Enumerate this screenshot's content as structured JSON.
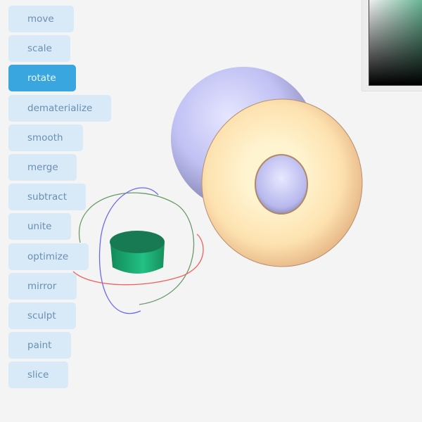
{
  "toolbar": {
    "active_tool": "rotate",
    "tools": [
      {
        "label": "move"
      },
      {
        "label": "scale"
      },
      {
        "label": "rotate"
      },
      {
        "label": "dematerialize"
      },
      {
        "label": "smooth"
      },
      {
        "label": "merge"
      },
      {
        "label": "subtract"
      },
      {
        "label": "unite"
      },
      {
        "label": "optimize"
      },
      {
        "label": "mirror"
      },
      {
        "label": "sculpt"
      },
      {
        "label": "paint"
      },
      {
        "label": "slice"
      }
    ]
  },
  "scene": {
    "objects": [
      {
        "name": "sphere",
        "color": "#c8c8f8"
      },
      {
        "name": "torus",
        "color": "#fcd9a4"
      },
      {
        "name": "cylinder",
        "color": "#1fa86e",
        "selected": true
      }
    ],
    "gizmo": {
      "type": "rotate",
      "axis_colors": {
        "x": "#f06060",
        "y": "#6a9a6a",
        "z": "#6a6af0"
      }
    }
  },
  "color_picker": {
    "hue_color": "#55b48c"
  }
}
